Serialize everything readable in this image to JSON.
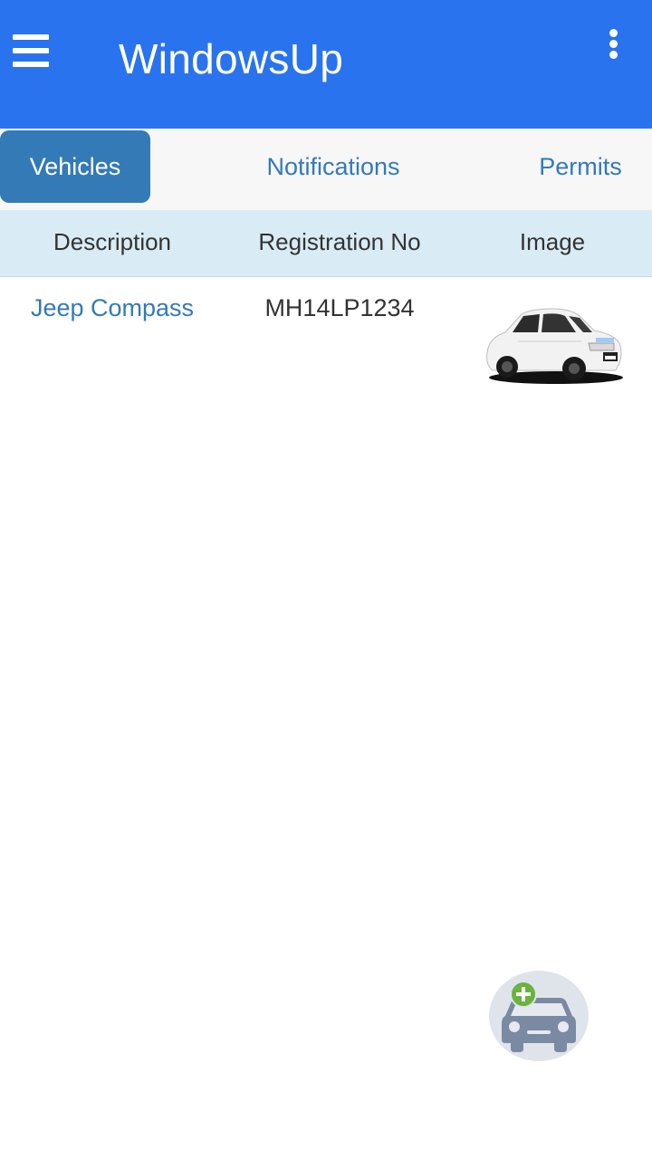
{
  "app": {
    "title": "WindowsUp"
  },
  "icons": {
    "menu": "hamburger-menu-icon",
    "more": "more-vert-icon",
    "add_vehicle": "add-car-icon",
    "vehicle_thumb": "car-photo"
  },
  "colors": {
    "appbar": "#2a73ee",
    "accent": "#337ab7",
    "header_bg": "#d9ebf5",
    "add_badge": "#6ab33e"
  },
  "tabs": [
    {
      "label": "Vehicles",
      "active": true
    },
    {
      "label": "Notifications",
      "active": false
    },
    {
      "label": "Permits",
      "active": false
    }
  ],
  "table": {
    "headers": [
      "Description",
      "Registration No",
      "Image"
    ],
    "rows": [
      {
        "description": "Jeep Compass",
        "registration": "MH14LP1234",
        "image": "white sedan car photo"
      }
    ]
  }
}
